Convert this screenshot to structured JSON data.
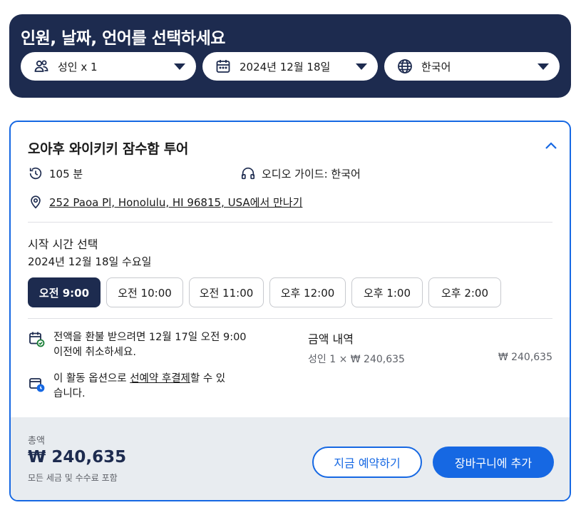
{
  "header": {
    "title": "인원, 날짜, 언어를 선택하세요",
    "travelers": {
      "icon": "travelers-icon",
      "label": "성인 x 1"
    },
    "date": {
      "icon": "calendar-icon",
      "label": "2024년 12월 18일"
    },
    "language": {
      "icon": "globe-icon",
      "label": "한국어"
    }
  },
  "activity": {
    "title": "오아후 와이키키 잠수함 투어",
    "duration": "105 분",
    "audio_guide": "오디오 가이드: 한국어",
    "meeting_address": "252 Paoa Pl, Honolulu, HI 96815, USA",
    "meeting_suffix": "에서 만나기"
  },
  "time_selection": {
    "label": "시작 시간 선택",
    "date": "2024년 12월 18일 수요일",
    "slots": [
      "오전 9:00",
      "오전 10:00",
      "오전 11:00",
      "오후 12:00",
      "오후 1:00",
      "오후 2:00"
    ],
    "selected_index": 0
  },
  "policies": {
    "refund_line1": "전액을 환불 받으려면 12월 17일 오전 9:00",
    "refund_line2": "이전에 취소하세요.",
    "reserve_prefix": "이 활동 옵션으로 ",
    "reserve_link": "선예약 후결제",
    "reserve_suffix": "할 수 있",
    "reserve_line2": "습니다."
  },
  "price_breakdown": {
    "title": "금액 내역",
    "line_label": "성인 1 × ₩ 240,635",
    "line_amount": "₩ 240,635"
  },
  "footer": {
    "total_label": "총액",
    "total_amount": "₩ 240,635",
    "total_note": "모든 세금 및 수수료 포함",
    "book_now": "지금 예약하기",
    "add_to_cart": "장바구니에 추가"
  },
  "colors": {
    "navy": "#1d2b4f",
    "accent_blue": "#1668e3",
    "footer_bg": "#e8ecf0"
  }
}
